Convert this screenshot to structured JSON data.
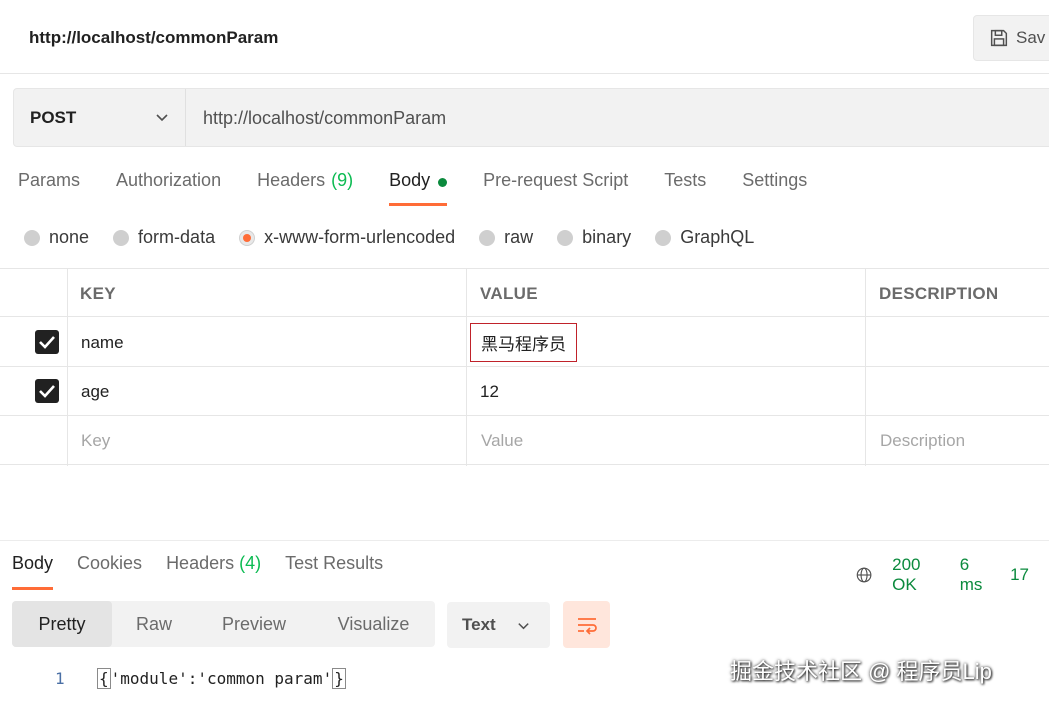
{
  "topbar": {
    "title": "http://localhost/commonParam",
    "save_label": "Sav"
  },
  "request": {
    "method": "POST",
    "url": "http://localhost/commonParam"
  },
  "request_tabs": [
    {
      "label": "Params"
    },
    {
      "label": "Authorization"
    },
    {
      "label": "Headers",
      "count": "(9)"
    },
    {
      "label": "Body",
      "active": true
    },
    {
      "label": "Pre-request Script"
    },
    {
      "label": "Tests"
    },
    {
      "label": "Settings"
    }
  ],
  "body_types": [
    "none",
    "form-data",
    "x-www-form-urlencoded",
    "raw",
    "binary",
    "GraphQL"
  ],
  "body_selected": "x-www-form-urlencoded",
  "table": {
    "headers": {
      "key": "KEY",
      "value": "VALUE",
      "description": "DESCRIPTION"
    },
    "rows": [
      {
        "key": "name",
        "value": "黑马程序员"
      },
      {
        "key": "age",
        "value": "12"
      }
    ],
    "placeholder": {
      "key": "Key",
      "value": "Value",
      "description": "Description"
    }
  },
  "response_tabs": [
    {
      "label": "Body",
      "active": true
    },
    {
      "label": "Cookies"
    },
    {
      "label": "Headers",
      "count": "(4)"
    },
    {
      "label": "Test Results"
    }
  ],
  "status": {
    "code": "200 OK",
    "time": "6 ms",
    "size": "17"
  },
  "view_modes": [
    "Pretty",
    "Raw",
    "Preview",
    "Visualize"
  ],
  "format": "Text",
  "code": {
    "line": "1",
    "open": "{",
    "content": "'module':'common param'",
    "close": "}"
  },
  "watermark": "掘金技术社区 @ 程序员Lip",
  "colors": {
    "accent": "#ff6c37",
    "success": "#0cbb52",
    "highlight_border": "#c0222a"
  }
}
